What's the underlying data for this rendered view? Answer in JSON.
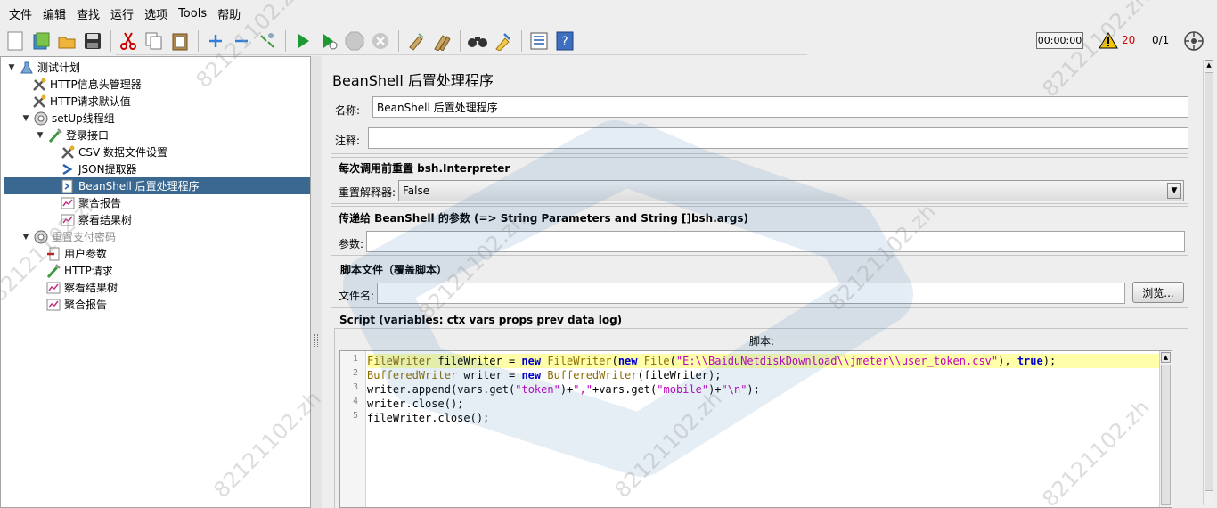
{
  "menu": [
    "文件",
    "编辑",
    "查找",
    "运行",
    "选项",
    "Tools",
    "帮助"
  ],
  "toolbar": {
    "icons": [
      "new-icon",
      "templates-icon",
      "open-icon",
      "save-icon",
      "cut-icon",
      "copy-icon",
      "paste-icon",
      "expand-icon",
      "collapse-icon",
      "toggle-icon",
      "start-icon",
      "start-no-pause-icon",
      "stop-icon",
      "shutdown-icon",
      "clear-icon",
      "clear-all-icon",
      "search-icon",
      "reset-search-icon",
      "function-helper-icon",
      "help-icon"
    ]
  },
  "status": {
    "elapsed": "00:00:00",
    "warnings": "20",
    "threads": "0/1"
  },
  "tree": [
    {
      "label": "测试计划",
      "icon": "test-plan-icon",
      "twist": "▼"
    },
    {
      "label": "HTTP信息头管理器",
      "icon": "config-icon",
      "twist": ""
    },
    {
      "label": "HTTP请求默认值",
      "icon": "config-icon",
      "twist": ""
    },
    {
      "label": "setUp线程组",
      "icon": "thread-group-icon",
      "twist": "▼"
    },
    {
      "label": "登录接口",
      "icon": "sampler-icon",
      "twist": "▼"
    },
    {
      "label": "CSV 数据文件设置",
      "icon": "config-icon",
      "twist": ""
    },
    {
      "label": "JSON提取器",
      "icon": "extractor-icon",
      "twist": ""
    },
    {
      "label": "BeanShell 后置处理程序",
      "icon": "beanshell-icon",
      "twist": ""
    },
    {
      "label": "聚合报告",
      "icon": "listener-icon",
      "twist": ""
    },
    {
      "label": "察看结果树",
      "icon": "listener-icon",
      "twist": ""
    },
    {
      "label": "重置支付密码",
      "icon": "thread-group-icon",
      "twist": "▼"
    },
    {
      "label": "用户参数",
      "icon": "preprocessor-icon",
      "twist": ""
    },
    {
      "label": "HTTP请求",
      "icon": "sampler-icon",
      "twist": ""
    },
    {
      "label": "察看结果树",
      "icon": "listener-icon",
      "twist": ""
    },
    {
      "label": "聚合报告",
      "icon": "listener-icon",
      "twist": ""
    }
  ],
  "panel": {
    "title": "BeanShell 后置处理程序",
    "name_label": "名称:",
    "name_value": "BeanShell 后置处理程序",
    "comment_label": "注释:",
    "comment_value": "",
    "reset_section": "每次调用前重置 bsh.Interpreter",
    "reset_label": "重置解释器:",
    "reset_value": "False",
    "params_section": "传递给 BeanShell 的参数 (=> String Parameters and String []bsh.args)",
    "params_label": "参数:",
    "params_value": "",
    "file_section": "脚本文件（覆盖脚本）",
    "file_label": "文件名:",
    "file_value": "",
    "browse_label": "浏览...",
    "script_section": "Script (variables: ctx vars props prev data log)",
    "script_label": "脚本:"
  },
  "script": {
    "line_numbers": [
      "1",
      "2",
      "3",
      "4",
      "5"
    ],
    "lines": [
      "FileWriter fileWriter = new FileWriter(new File(\"E:\\\\BaiduNetdiskDownload\\\\jmeter\\\\user_token.csv\"), true);",
      "BufferedWriter writer = new BufferedWriter(fileWriter);",
      "writer.append(vars.get(\"token\")+\",\"+vars.get(\"mobile\")+\"\\n\");",
      "writer.close();",
      "fileWriter.close();"
    ]
  },
  "watermark": "82121102.zh"
}
